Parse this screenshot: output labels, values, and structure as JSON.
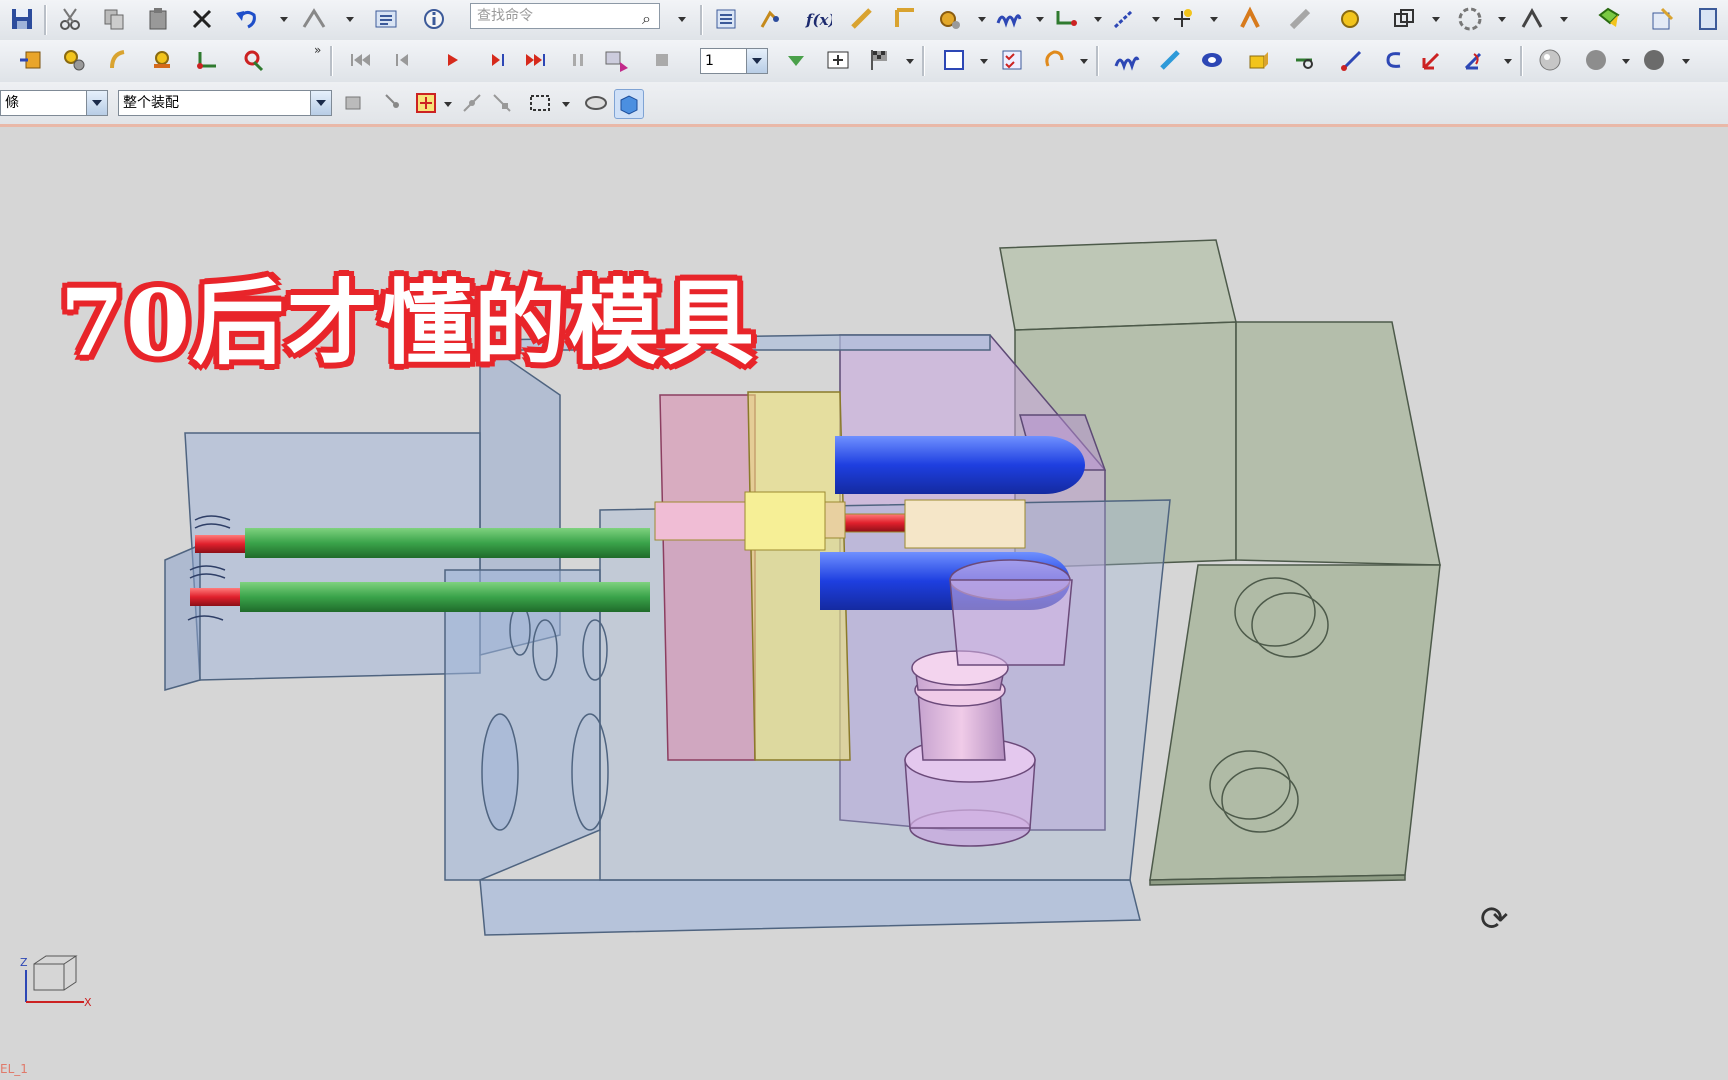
{
  "search": {
    "placeholder": "查找命令"
  },
  "frame_field": {
    "value": "1"
  },
  "filter_combo": {
    "value": "條"
  },
  "assembly_combo": {
    "value": "整个装配"
  },
  "banner": {
    "text": "70后才懂的模具"
  },
  "view_triad": {
    "z_label": "Z",
    "x_label": "X"
  },
  "status": {
    "text": "EL_1"
  },
  "colors": {
    "banner_outline": "#e8252a",
    "mold_base": "#9fb4d8",
    "clamp_block": "#a7b59a",
    "pink_plate": "#d98fb0",
    "yellow_plate": "#eee27a",
    "violet_plate": "#c9a6e0",
    "cylinder_blue": "#1e3fe0",
    "rod_green": "#3aa34a",
    "tip_red": "#e0202c"
  },
  "icons": [
    "save-icon",
    "cut-icon",
    "copy-icon",
    "paste-icon",
    "delete-icon",
    "undo-icon",
    "function-icon",
    "gear-icon",
    "spring-icon",
    "play-icon",
    "stop-icon",
    "sphere-icon"
  ]
}
